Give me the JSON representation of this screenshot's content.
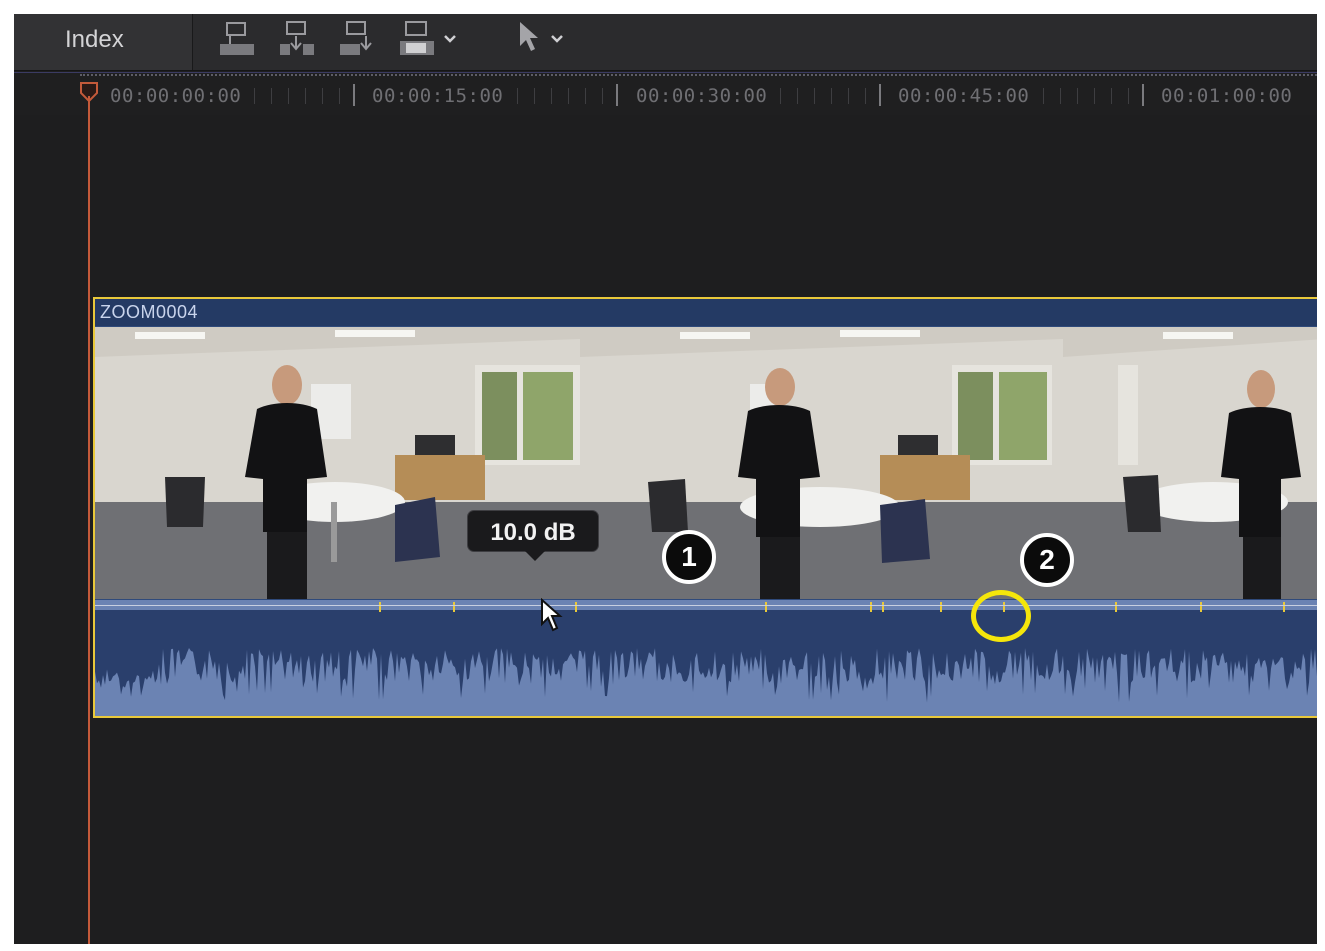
{
  "toolbar": {
    "index_label": "Index",
    "buttons": [
      "connect-clip-icon",
      "insert-clip-icon",
      "append-clip-icon",
      "overwrite-clip-icon",
      "select-tool-icon"
    ]
  },
  "ruler": {
    "timecodes": [
      "00:00:00:00",
      "00:00:15:00",
      "00:00:30:00",
      "00:00:45:00",
      "00:01:00:00"
    ]
  },
  "clip": {
    "name": "ZOOM0004",
    "volume_tooltip": "10.0 dB"
  },
  "callouts": {
    "one": "1",
    "two": "2"
  },
  "colors": {
    "playhead": "#c45a3a",
    "clip_border": "#e9c93b",
    "audio_waveform": "#2a3f6c",
    "highlight": "#f5e60b"
  }
}
